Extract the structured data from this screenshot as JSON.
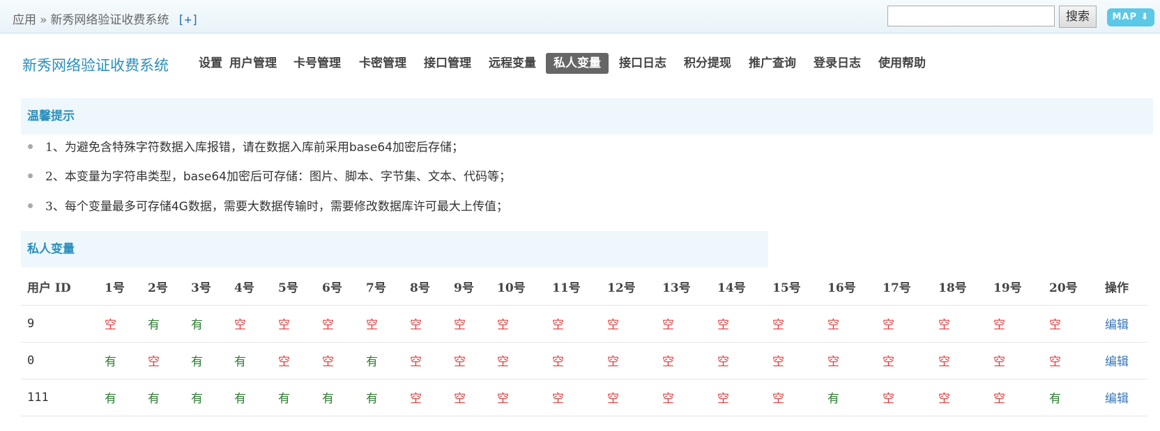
{
  "breadcrumb": {
    "root": "应用",
    "separator": "»",
    "current": "新秀网络验证收费系统",
    "add": "[+]"
  },
  "search": {
    "value": "",
    "button": "搜索"
  },
  "map_button": "MAP ⬇",
  "brand": "新秀网络验证收费系统",
  "nav": [
    "设置",
    "用户管理",
    "卡号管理",
    "卡密管理",
    "接口管理",
    "远程变量",
    "私人变量",
    "接口日志",
    "积分提现",
    "推广查询",
    "登录日志",
    "使用帮助"
  ],
  "nav_active": "私人变量",
  "tips_panel": {
    "title": "温馨提示",
    "items": [
      [
        "1、为避免含特殊字符数据入库报错，请在数据入库前采用",
        "base64",
        "加密后存储；"
      ],
      [
        "2、本变量为字符串类型，",
        "base64",
        "加密后可存储：图片、脚本、字节集、文本、代码等；"
      ],
      [
        "3、每个变量最多可存储",
        "4G",
        "数据，需要大数据传输时，需要修改数据库许可最大上传值；"
      ]
    ]
  },
  "vars_panel": {
    "title": "私人变量",
    "columns": {
      "user_id": "用户 ID",
      "slots": [
        "1号",
        "2号",
        "3号",
        "4号",
        "5号",
        "6号",
        "7号",
        "8号",
        "9号",
        "10号",
        "11号",
        "12号",
        "13号",
        "14号",
        "15号",
        "16号",
        "17号",
        "18号",
        "19号",
        "20号"
      ],
      "action": "操作"
    },
    "rows": [
      {
        "uid": "9",
        "slots": [
          "空",
          "有",
          "有",
          "空",
          "空",
          "空",
          "空",
          "空",
          "空",
          "空",
          "空",
          "空",
          "空",
          "空",
          "空",
          "空",
          "空",
          "空",
          "空",
          "空"
        ],
        "action": "编辑"
      },
      {
        "uid": "0",
        "slots": [
          "有",
          "空",
          "有",
          "有",
          "空",
          "空",
          "有",
          "空",
          "空",
          "空",
          "空",
          "空",
          "空",
          "空",
          "空",
          "空",
          "空",
          "空",
          "空",
          "空"
        ],
        "action": "编辑"
      },
      {
        "uid": "111",
        "slots": [
          "有",
          "有",
          "有",
          "有",
          "有",
          "有",
          "有",
          "空",
          "空",
          "空",
          "空",
          "空",
          "空",
          "空",
          "空",
          "有",
          "空",
          "空",
          "空",
          "有"
        ],
        "action": "编辑"
      }
    ]
  },
  "colors": {
    "accent": "#2a8fbd",
    "empty": "#e03a3a",
    "has": "#2e7d32",
    "link": "#3b78b8",
    "panel_bg": "#eef7fc"
  }
}
